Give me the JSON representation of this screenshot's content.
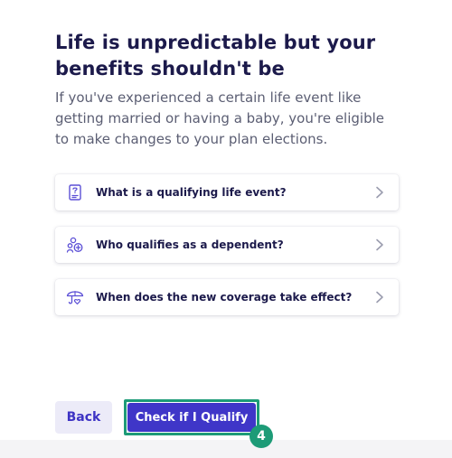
{
  "header": {
    "title": "Life is unpredictable but your benefits shouldn't be",
    "description": "If you've experienced a certain life event like getting married or having a baby, you're eligible to make changes to your plan elections."
  },
  "faq": {
    "items": [
      {
        "label": "What is a qualifying life event?",
        "icon": "document-icon"
      },
      {
        "label": "Who qualifies as a dependent?",
        "icon": "dependents-icon"
      },
      {
        "label": "When does the new coverage take effect?",
        "icon": "umbrella-heart-icon"
      }
    ]
  },
  "actions": {
    "back_label": "Back",
    "qualify_label": "Check if I Qualify"
  },
  "annotation": {
    "step_number": "4"
  },
  "colors": {
    "heading": "#1c1a4b",
    "body_text": "#5b5e73",
    "primary": "#3f36c8",
    "secondary_bg": "#ecebf8",
    "icon": "#5b4fd6",
    "highlight": "#1d9b77"
  }
}
